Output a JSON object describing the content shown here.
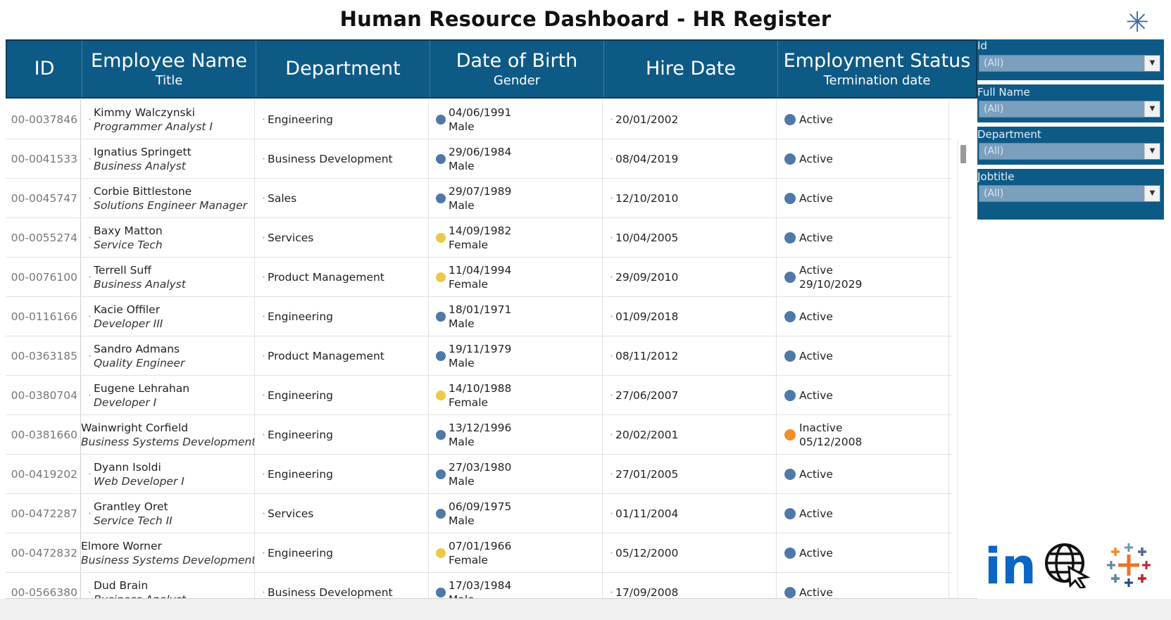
{
  "page": {
    "title": "Human Resource Dashboard - HR Register"
  },
  "icons": {
    "reset": "asterisk-icon",
    "linkedin": "linkedin-icon",
    "web": "globe-cursor-icon",
    "tableau": "tableau-icon"
  },
  "colors": {
    "header": "#0e5a87",
    "male": "#4e79a7",
    "female": "#edc948",
    "active": "#4e79a7",
    "inactive": "#f28e2b"
  },
  "table": {
    "headers": {
      "id": "ID",
      "name": "Employee Name",
      "name_sub": "Title",
      "dept": "Department",
      "dob": "Date of Birth",
      "dob_sub": "Gender",
      "hire": "Hire Date",
      "status": "Employment Status",
      "status_sub": "Termination date"
    },
    "rows": [
      {
        "id": "00-0037846",
        "name": "Kimmy Walczynski",
        "title": "Programmer Analyst I",
        "dept": "Engineering",
        "dob": "04/06/1991",
        "gender": "Male",
        "hire": "20/01/2002",
        "status": "Active",
        "term": ""
      },
      {
        "id": "00-0041533",
        "name": "Ignatius Springett",
        "title": "Business Analyst",
        "dept": "Business Development",
        "dob": "29/06/1984",
        "gender": "Male",
        "hire": "08/04/2019",
        "status": "Active",
        "term": ""
      },
      {
        "id": "00-0045747",
        "name": "Corbie Bittlestone",
        "title": "Solutions Engineer Manager",
        "dept": "Sales",
        "dob": "29/07/1989",
        "gender": "Male",
        "hire": "12/10/2010",
        "status": "Active",
        "term": ""
      },
      {
        "id": "00-0055274",
        "name": "Baxy Matton",
        "title": "Service Tech",
        "dept": "Services",
        "dob": "14/09/1982",
        "gender": "Female",
        "hire": "10/04/2005",
        "status": "Active",
        "term": ""
      },
      {
        "id": "00-0076100",
        "name": "Terrell Suff",
        "title": "Business Analyst",
        "dept": "Product Management",
        "dob": "11/04/1994",
        "gender": "Female",
        "hire": "29/09/2010",
        "status": "Active",
        "term": "29/10/2029"
      },
      {
        "id": "00-0116166",
        "name": "Kacie Offiler",
        "title": "Developer III",
        "dept": "Engineering",
        "dob": "18/01/1971",
        "gender": "Male",
        "hire": "01/09/2018",
        "status": "Active",
        "term": ""
      },
      {
        "id": "00-0363185",
        "name": "Sandro Admans",
        "title": "Quality Engineer",
        "dept": "Product Management",
        "dob": "19/11/1979",
        "gender": "Male",
        "hire": "08/11/2012",
        "status": "Active",
        "term": ""
      },
      {
        "id": "00-0380704",
        "name": "Eugene Lehrahan",
        "title": "Developer I",
        "dept": "Engineering",
        "dob": "14/10/1988",
        "gender": "Female",
        "hire": "27/06/2007",
        "status": "Active",
        "term": ""
      },
      {
        "id": "00-0381660",
        "name": "Wainwright Corfield",
        "title": "Business Systems Development An",
        "dept": "Engineering",
        "dob": "13/12/1996",
        "gender": "Male",
        "hire": "20/02/2001",
        "status": "Inactive",
        "term": "05/12/2008"
      },
      {
        "id": "00-0419202",
        "name": "Dyann Isoldi",
        "title": "Web Developer I",
        "dept": "Engineering",
        "dob": "27/03/1980",
        "gender": "Male",
        "hire": "27/01/2005",
        "status": "Active",
        "term": ""
      },
      {
        "id": "00-0472287",
        "name": "Grantley Oret",
        "title": "Service Tech II",
        "dept": "Services",
        "dob": "06/09/1975",
        "gender": "Male",
        "hire": "01/11/2004",
        "status": "Active",
        "term": ""
      },
      {
        "id": "00-0472832",
        "name": "Elmore Worner",
        "title": "Business Systems Development An",
        "dept": "Engineering",
        "dob": "07/01/1966",
        "gender": "Female",
        "hire": "05/12/2000",
        "status": "Active",
        "term": ""
      },
      {
        "id": "00-0566380",
        "name": "Dud Brain",
        "title": "Business Analyst",
        "dept": "Business Development",
        "dob": "17/03/1984",
        "gender": "Male",
        "hire": "17/09/2008",
        "status": "Active",
        "term": ""
      }
    ]
  },
  "filters": [
    {
      "label": "Id",
      "value": "(All)"
    },
    {
      "label": "Full Name",
      "value": "(All)"
    },
    {
      "label": "Department",
      "value": "(All)"
    },
    {
      "label": "Jobtitle",
      "value": "(All)"
    }
  ]
}
